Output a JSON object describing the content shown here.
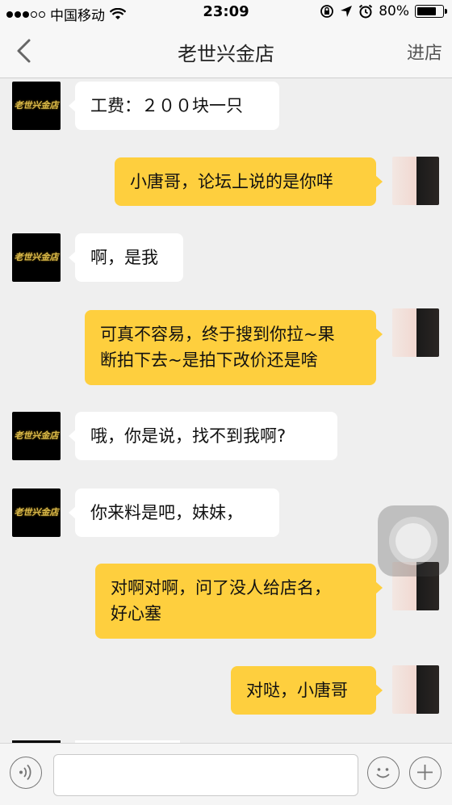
{
  "status_bar": {
    "carrier": "中国移动",
    "time": "23:09",
    "battery": "80%",
    "battery_level": 0.8,
    "signal_bars": 3,
    "icons": [
      "wifi-icon",
      "rotation-lock-icon",
      "location-icon",
      "alarm-icon",
      "battery-icon"
    ]
  },
  "nav": {
    "title": "老世兴金店",
    "back_icon": "chevron-left-icon",
    "right_label": "进店"
  },
  "store_avatar_text": "老世兴金店",
  "messages": [
    {
      "side": "left",
      "lines": [
        "工费：２００块一只"
      ]
    },
    {
      "side": "right",
      "lines": [
        "小唐哥，论坛上说的是你咩"
      ]
    },
    {
      "side": "left",
      "lines": [
        "啊，是我"
      ]
    },
    {
      "side": "right",
      "lines": [
        "可真不容易，终于搜到你拉~果",
        "断拍下去~是拍下改价还是啥"
      ]
    },
    {
      "side": "left",
      "lines": [
        "哦，你是说，找不到我啊?"
      ]
    },
    {
      "side": "left",
      "lines": [
        "你来料是吧，妹妹，"
      ]
    },
    {
      "side": "right",
      "lines": [
        "对啊对啊，问了没人给店名，",
        "好心塞"
      ]
    },
    {
      "side": "right",
      "lines": [
        "对哒，小唐哥"
      ]
    }
  ],
  "input_bar": {
    "voice_icon": "voice-icon",
    "text_value": "",
    "emoji_icon": "emoji-icon",
    "plus_icon": "plus-icon"
  },
  "colors": {
    "outgoing_bubble": "#fecf3e",
    "incoming_bubble": "#ffffff",
    "chat_background": "#efefef"
  }
}
